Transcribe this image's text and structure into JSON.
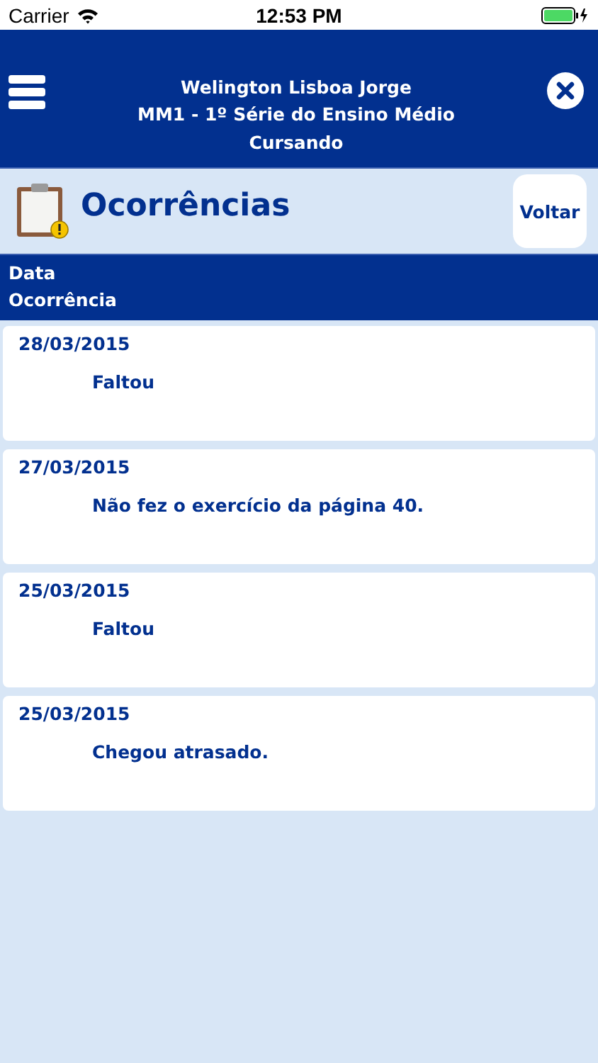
{
  "status_bar": {
    "carrier": "Carrier",
    "time": "12:53 PM"
  },
  "header": {
    "lines": [
      "Welington Lisboa Jorge",
      "MM1 - 1º Série do Ensino Médio",
      "Cursando"
    ]
  },
  "title_bar": {
    "title": "Ocorrências",
    "back_button": "Voltar"
  },
  "columns": [
    "Data",
    "Ocorrência"
  ],
  "occurrences": [
    {
      "date": "28/03/2015",
      "text": "Faltou"
    },
    {
      "date": "27/03/2015",
      "text": "Não fez o exercício da página 40."
    },
    {
      "date": "25/03/2015",
      "text": "Faltou"
    },
    {
      "date": "25/03/2015",
      "text": "Chegou atrasado."
    }
  ]
}
